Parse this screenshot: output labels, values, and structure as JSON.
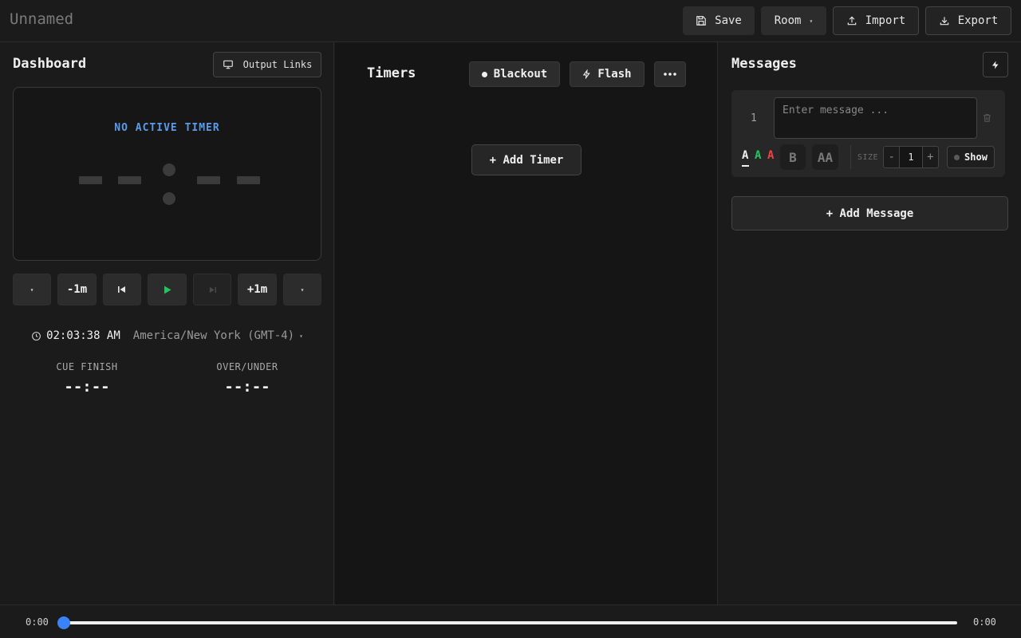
{
  "header": {
    "project_name": "Unnamed",
    "save_label": "Save",
    "room_label": "Room",
    "import_label": "Import",
    "export_label": "Export"
  },
  "dashboard": {
    "title": "Dashboard",
    "output_links_label": "Output Links",
    "status_text": "NO ACTIVE TIMER",
    "controls": {
      "minus_one_label": "-1m",
      "plus_one_label": "+1m"
    },
    "clock": {
      "time": "02:03:38 AM",
      "timezone": "America/New York (GMT-4)"
    },
    "cue_finish": {
      "label": "CUE FINISH",
      "value": "--:--"
    },
    "over_under": {
      "label": "OVER/UNDER",
      "value": "--:--"
    }
  },
  "timers": {
    "title": "Timers",
    "blackout_label": "Blackout",
    "flash_label": "Flash",
    "add_timer_label": "+ Add Timer"
  },
  "messages": {
    "title": "Messages",
    "items": [
      {
        "index": "1",
        "placeholder": "Enter message ...",
        "size_label": "SIZE",
        "size_value": "1",
        "bold_label": "B",
        "caps_label": "AA",
        "color_labels": [
          "A",
          "A",
          "A"
        ],
        "show_label": "Show"
      }
    ],
    "add_message_label": "+ Add Message"
  },
  "playback": {
    "current_time": "0:00",
    "total_time": "0:00"
  },
  "colors": {
    "accent_blue": "#3b82f6",
    "status_blue": "#5b9bea",
    "play_green": "#22c55e",
    "text_white": "#f0f0f0",
    "message_green": "#22c55e",
    "message_red": "#ef4444"
  }
}
